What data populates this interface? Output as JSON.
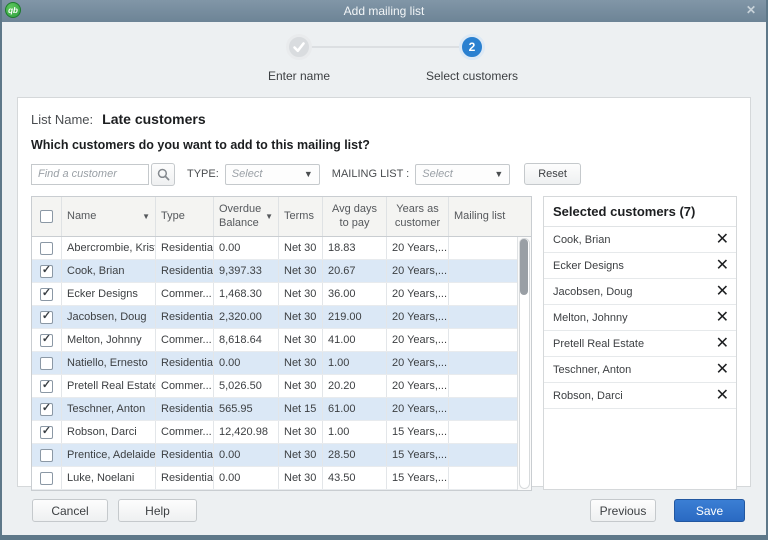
{
  "window": {
    "title": "Add mailing list",
    "close_glyph": "✕"
  },
  "app_icon_text": "qb",
  "steps": {
    "step1": {
      "label": "Enter name"
    },
    "step2": {
      "label": "Select customers",
      "number": "2"
    }
  },
  "form": {
    "list_name_label": "List Name:",
    "list_name_value": "Late customers",
    "question": "Which customers do you want to add to this mailing list?",
    "search_placeholder": "Find a customer",
    "type_label": "TYPE:",
    "type_value": "Select",
    "mailing_list_label": "MAILING LIST :",
    "mailing_list_value": "Select",
    "reset_label": "Reset",
    "dropdown_arrow": "▼"
  },
  "table": {
    "columns": {
      "name": "Name",
      "type": "Type",
      "overdue": "Overdue Balance",
      "terms": "Terms",
      "avg_days": "Avg days to pay",
      "years": "Years as customer",
      "mailing": "Mailing list"
    },
    "sort_glyph": "▼",
    "rows": [
      {
        "checked": false,
        "name": "Abercrombie, Kristy",
        "type": "Residential",
        "overdue": "0.00",
        "terms": "Net 30",
        "avg_days": "18.83",
        "years": "20 Years,...",
        "mailing": ""
      },
      {
        "checked": true,
        "name": "Cook, Brian",
        "type": "Residential",
        "overdue": "9,397.33",
        "terms": "Net 30",
        "avg_days": "20.67",
        "years": "20 Years,...",
        "mailing": ""
      },
      {
        "checked": true,
        "name": "Ecker Designs",
        "type": "Commer...",
        "overdue": "1,468.30",
        "terms": "Net 30",
        "avg_days": "36.00",
        "years": "20 Years,...",
        "mailing": ""
      },
      {
        "checked": true,
        "name": "Jacobsen, Doug",
        "type": "Residential",
        "overdue": "2,320.00",
        "terms": "Net 30",
        "avg_days": "219.00",
        "years": "20 Years,...",
        "mailing": ""
      },
      {
        "checked": true,
        "name": "Melton, Johnny",
        "type": "Commer...",
        "overdue": "8,618.64",
        "terms": "Net 30",
        "avg_days": "41.00",
        "years": "20 Years,...",
        "mailing": ""
      },
      {
        "checked": false,
        "name": "Natiello, Ernesto",
        "type": "Residential",
        "overdue": "0.00",
        "terms": "Net 30",
        "avg_days": "1.00",
        "years": "20 Years,...",
        "mailing": ""
      },
      {
        "checked": true,
        "name": "Pretell Real Estate",
        "type": "Commer...",
        "overdue": "5,026.50",
        "terms": "Net 30",
        "avg_days": "20.20",
        "years": "20 Years,...",
        "mailing": ""
      },
      {
        "checked": true,
        "name": "Teschner, Anton",
        "type": "Residential",
        "overdue": "565.95",
        "terms": "Net 15",
        "avg_days": "61.00",
        "years": "20 Years,...",
        "mailing": ""
      },
      {
        "checked": true,
        "name": "Robson, Darci",
        "type": "Commer...",
        "overdue": "12,420.98",
        "terms": "Net 30",
        "avg_days": "1.00",
        "years": "15 Years,...",
        "mailing": ""
      },
      {
        "checked": false,
        "name": "Prentice, Adelaide",
        "type": "Residential",
        "overdue": "0.00",
        "terms": "Net 30",
        "avg_days": "28.50",
        "years": "15 Years,...",
        "mailing": ""
      },
      {
        "checked": false,
        "name": "Luke, Noelani",
        "type": "Residential",
        "overdue": "0.00",
        "terms": "Net 30",
        "avg_days": "43.50",
        "years": "15 Years,...",
        "mailing": ""
      }
    ]
  },
  "selected": {
    "title": "Selected customers (7)",
    "remove_glyph": "✕",
    "items": [
      "Cook, Brian",
      "Ecker Designs",
      "Jacobsen, Doug",
      "Melton, Johnny",
      "Pretell Real Estate",
      "Teschner, Anton",
      "Robson, Darci"
    ]
  },
  "footer": {
    "cancel": "Cancel",
    "help": "Help",
    "previous": "Previous",
    "save": "Save"
  },
  "colors": {
    "titlebar": "#7b91a3",
    "accent_blue": "#2a80d0",
    "save_blue": "#2f6fc9",
    "row_alt": "#dbe8f6",
    "qb_green": "#2f9e3f"
  }
}
